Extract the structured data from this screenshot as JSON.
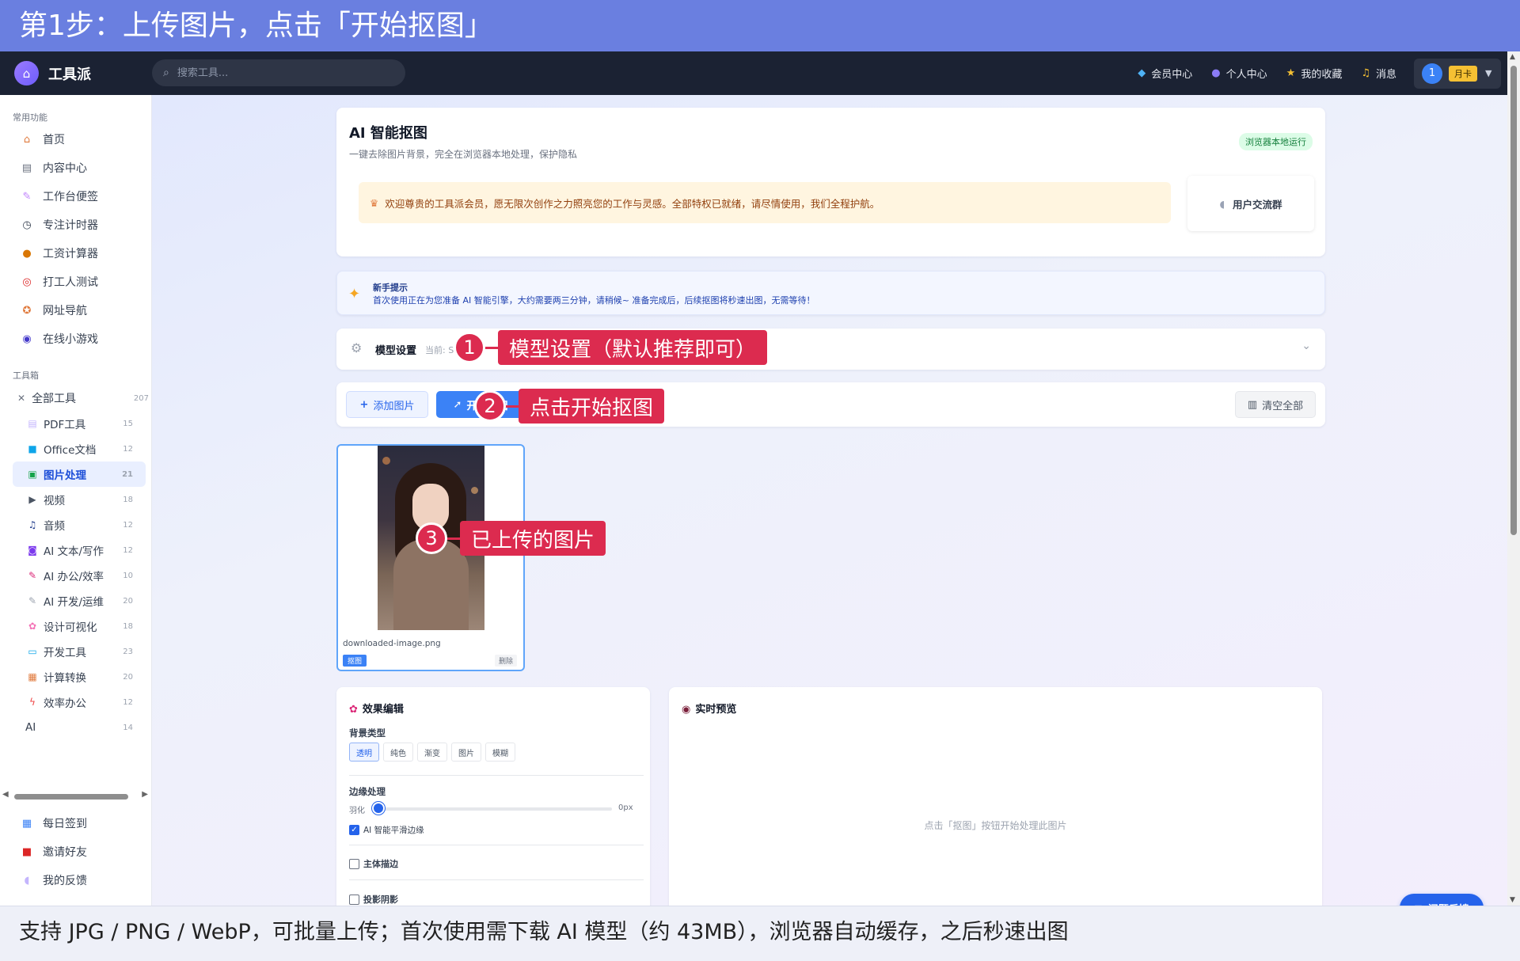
{
  "tutorial": {
    "top": "第1步：上传图片，点击「开始抠图」",
    "bottom": "支持 JPG / PNG / WebP，可批量上传；首次使用需下载 AI 模型（约 43MB），浏览器自动缓存，之后秒速出图"
  },
  "nav": {
    "brand": "工具派",
    "search_placeholder": "搜索工具...",
    "links": [
      {
        "label": "会员中心",
        "icon": "diamond-icon"
      },
      {
        "label": "个人中心",
        "icon": "person-icon"
      },
      {
        "label": "我的收藏",
        "icon": "star-icon"
      },
      {
        "label": "消息",
        "icon": "bell-icon"
      }
    ],
    "user_number": "1",
    "card_badge": "月卡"
  },
  "sidebar": {
    "common_title": "常用功能",
    "common": [
      {
        "label": "首页",
        "icon": "home-icon"
      },
      {
        "label": "内容中心",
        "icon": "news-icon"
      },
      {
        "label": "工作台便签",
        "icon": "memo-icon"
      },
      {
        "label": "专注计时器",
        "icon": "timer-icon"
      },
      {
        "label": "工资计算器",
        "icon": "money-bag-icon"
      },
      {
        "label": "打工人测试",
        "icon": "target-icon"
      },
      {
        "label": "网址导航",
        "icon": "compass-icon"
      },
      {
        "label": "在线小游戏",
        "icon": "gamepad-icon"
      }
    ],
    "toolbox_title": "工具箱",
    "all_tools": {
      "label": "全部工具",
      "count": "207"
    },
    "tools": [
      {
        "label": "PDF工具",
        "count": "15",
        "icon": "pdf-icon"
      },
      {
        "label": "Office文档",
        "count": "12",
        "icon": "document-icon"
      },
      {
        "label": "图片处理",
        "count": "21",
        "icon": "image-icon",
        "active": true
      },
      {
        "label": "视频",
        "count": "18",
        "icon": "clapper-icon"
      },
      {
        "label": "音频",
        "count": "12",
        "icon": "music-icon"
      },
      {
        "label": "AI 文本/写作",
        "count": "12",
        "icon": "robot-icon"
      },
      {
        "label": "AI 办公/效率",
        "count": "10",
        "icon": "pen-icon"
      },
      {
        "label": "AI 开发/运维",
        "count": "20",
        "icon": "wrench-icon"
      },
      {
        "label": "设计可视化",
        "count": "18",
        "icon": "palette-icon"
      },
      {
        "label": "开发工具",
        "count": "23",
        "icon": "laptop-icon"
      },
      {
        "label": "计算转换",
        "count": "20",
        "icon": "calculator-icon"
      },
      {
        "label": "效率办公",
        "count": "12",
        "icon": "lightning-icon"
      },
      {
        "label": "AI",
        "count": "14",
        "icon": ""
      }
    ],
    "bottom": [
      {
        "label": "每日签到",
        "icon": "calendar-icon"
      },
      {
        "label": "邀请好友",
        "icon": "gift-icon"
      },
      {
        "label": "我的反馈",
        "icon": "speech-bubble-icon"
      }
    ]
  },
  "header": {
    "title": "AI 智能抠图",
    "subtitle": "一键去除图片背景，完全在浏览器本地处理，保护隐私",
    "badge": "浏览器本地运行",
    "welcome": "欢迎尊贵的工具派会员，愿无限次创作之力照亮您的工作与灵感。全部特权已就绪，请尽情使用，我们全程护航。",
    "group_button": "用户交流群"
  },
  "tip": {
    "title": "新手提示",
    "text": "首次使用正在为您准备 AI 智能引擎，大约需要两三分钟，请稍候~ 准备完成后，后续抠图将秒速出图，无需等待！"
  },
  "model": {
    "title": "模型设置",
    "current": "当前: S"
  },
  "actions": {
    "add": "添加图片",
    "start": "开始抠图",
    "clear": "清空全部"
  },
  "image": {
    "filename": "downloaded-image.png",
    "cut": "抠图",
    "delete": "删除"
  },
  "editor": {
    "title": "效果编辑",
    "bg_label": "背景类型",
    "bg_options": [
      "透明",
      "纯色",
      "渐变",
      "图片",
      "模糊"
    ],
    "bg_selected": "透明",
    "edge_label": "边缘处理",
    "feather_label": "羽化",
    "feather_value": "0px",
    "feather_level": 0,
    "smooth_label": "AI 智能平滑边缘",
    "smooth_checked": true,
    "outline_label": "主体描边",
    "shadow_label": "投影阴影"
  },
  "preview": {
    "title": "实时预览",
    "empty": "点击「抠图」按钮开始处理此图片"
  },
  "feedback": "问题反馈",
  "callouts": [
    {
      "num": "1",
      "text": "模型设置（默认推荐即可）"
    },
    {
      "num": "2",
      "text": "点击开始抠图"
    },
    {
      "num": "3",
      "text": "已上传的图片"
    }
  ],
  "colors": {
    "banner": "#6a7fe0",
    "accent": "#3b82f6",
    "callout": "#dc2b4f",
    "nav": "#1b2233"
  }
}
